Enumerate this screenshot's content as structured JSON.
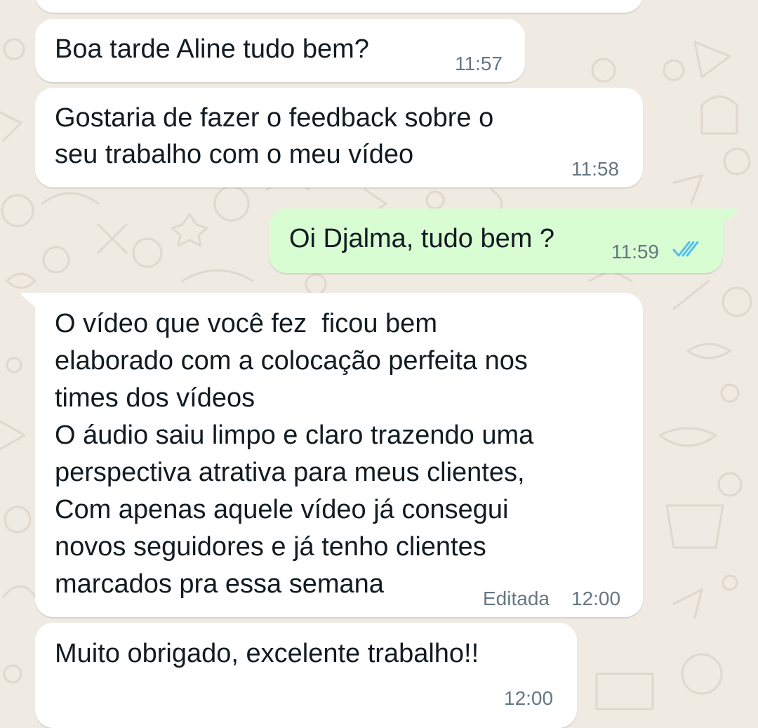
{
  "chat": {
    "messages": [
      {
        "direction": "incoming",
        "lines": [
          "Boa tarde Aline tudo bem?"
        ],
        "time": "11:57"
      },
      {
        "direction": "incoming",
        "lines": [
          "Gostaria de fazer o feedback sobre o",
          "seu trabalho com o meu vídeo"
        ],
        "time": "11:58"
      },
      {
        "direction": "outgoing",
        "lines": [
          "Oi Djalma, tudo bem ?"
        ],
        "time": "11:59",
        "status_icon": "double-check-read-icon"
      },
      {
        "direction": "incoming",
        "lines": [
          "O vídeo que você fez  ficou bem",
          "elaborado com a colocação perfeita nos",
          "times dos vídeos",
          "O áudio saiu limpo e claro trazendo uma",
          "perspectiva atrativa para meus clientes,",
          "Com apenas aquele vídeo já consegui",
          "novos seguidores e já tenho clientes",
          "marcados pra essa semana"
        ],
        "edited_label": "Editada",
        "time": "12:00"
      },
      {
        "direction": "incoming",
        "lines": [
          "Muito obrigado, excelente trabalho!!"
        ],
        "time": "12:00"
      }
    ]
  },
  "colors": {
    "background": "#efeae2",
    "incoming_bubble": "#ffffff",
    "outgoing_bubble": "#d9fdd3",
    "text": "#111b21",
    "meta_text": "#667781",
    "read_ticks": "#53bdeb"
  }
}
